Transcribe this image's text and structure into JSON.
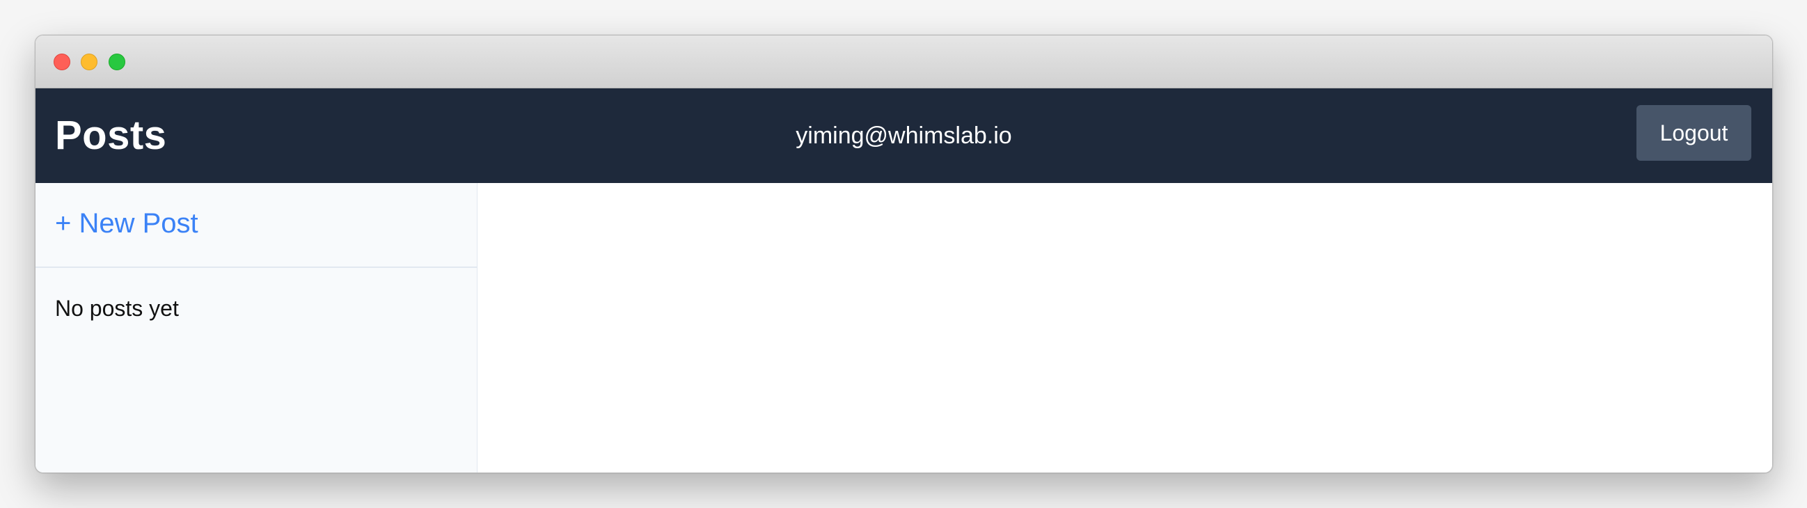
{
  "window": {
    "controls": [
      "close",
      "minimize",
      "maximize"
    ]
  },
  "header": {
    "title": "Posts",
    "user_email": "yiming@whimslab.io",
    "logout_label": "Logout"
  },
  "sidebar": {
    "new_post_label": "+ New Post",
    "empty_message": "No posts yet"
  },
  "colors": {
    "navbar": "#1e293b",
    "logout_button": "#475569",
    "link": "#3b82f6",
    "sidebar_bg": "#f8fafc"
  }
}
